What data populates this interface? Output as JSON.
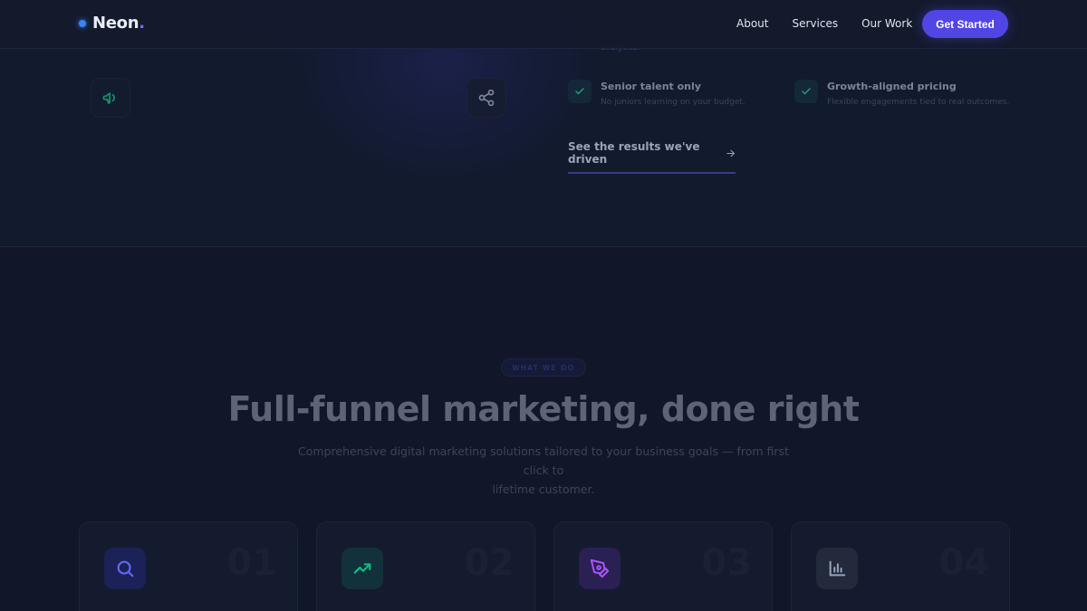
{
  "nav": {
    "logo_text": "Neon",
    "logo_period": ".",
    "links": [
      {
        "label": "About"
      },
      {
        "label": "Services"
      },
      {
        "label": "Our Work"
      }
    ],
    "cta_label": "Get Started"
  },
  "top": {
    "faded_paragraph_line1": "",
    "faded_paragraph_line2": "analytics.",
    "features": [
      {
        "title": "Senior talent only",
        "desc": "No juniors learning on your budget."
      },
      {
        "title": "Growth-aligned pricing",
        "desc": "Flexible engagements tied to real outcomes."
      }
    ],
    "results_link": "See the results we've driven",
    "icons": [
      "megaphone-icon",
      "share-icon",
      "check-icon",
      "arrow-right-icon"
    ]
  },
  "services": {
    "eyebrow": "WHAT WE DO",
    "headline": "Full-funnel marketing, done right",
    "subhead_line1": "Comprehensive digital marketing solutions tailored to your business goals — from first click to",
    "subhead_line2": "lifetime customer.",
    "cards": [
      {
        "number": "01",
        "icon": "search-icon",
        "accent": "#6366f1"
      },
      {
        "number": "02",
        "icon": "trending-up-icon",
        "accent": "#10b981"
      },
      {
        "number": "03",
        "icon": "pen-tool-icon",
        "accent": "#a855f7"
      },
      {
        "number": "04",
        "icon": "bar-chart-icon",
        "accent": "#94a3b8"
      }
    ]
  },
  "colors": {
    "background": "#111729",
    "primary": "#5146e5",
    "logo_dot": "#3b82f6"
  }
}
